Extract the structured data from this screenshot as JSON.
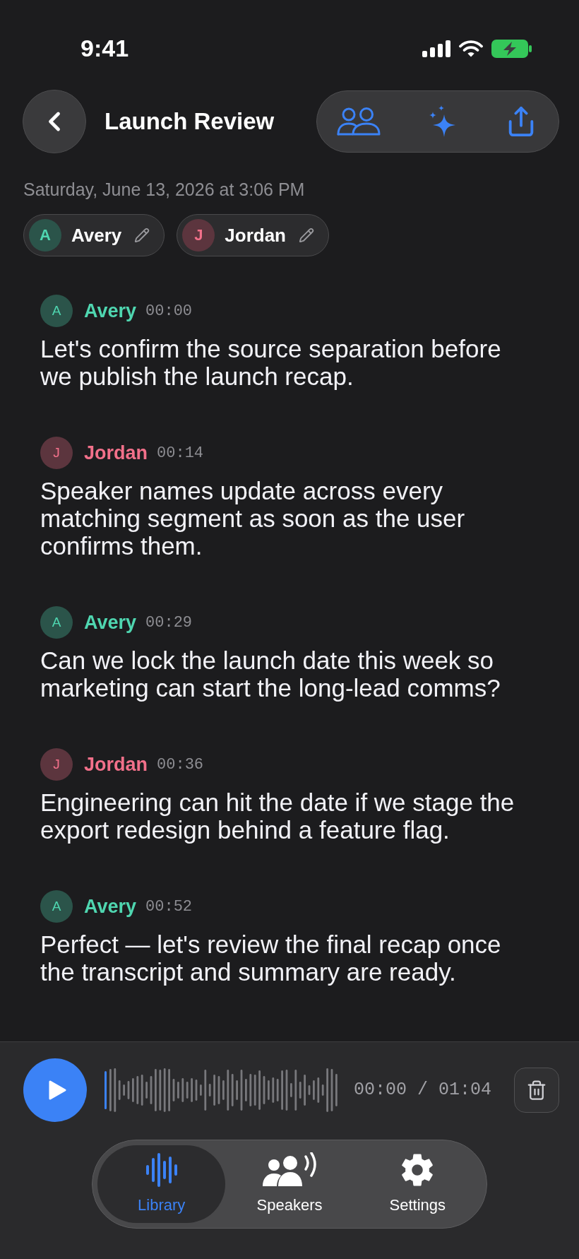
{
  "status_bar": {
    "time": "9:41"
  },
  "header": {
    "title": "Launch Review"
  },
  "date": "Saturday, June 13, 2026 at 3:06 PM",
  "speakers": [
    {
      "initial": "A",
      "name": "Avery",
      "color": "#4fd6b0"
    },
    {
      "initial": "J",
      "name": "Jordan",
      "color": "#f2708a"
    }
  ],
  "transcript": [
    {
      "initial": "A",
      "speaker": "Avery",
      "color": "#4fd6b0",
      "time": "00:00",
      "text": "Let's confirm the source separation before we publish the launch recap."
    },
    {
      "initial": "J",
      "speaker": "Jordan",
      "color": "#f2708a",
      "time": "00:14",
      "text": "Speaker names update across every matching segment as soon as the user confirms them."
    },
    {
      "initial": "A",
      "speaker": "Avery",
      "color": "#4fd6b0",
      "time": "00:29",
      "text": "Can we lock the launch date this week so marketing can start the long-lead comms?"
    },
    {
      "initial": "J",
      "speaker": "Jordan",
      "color": "#f2708a",
      "time": "00:36",
      "text": "Engineering can hit the date if we stage the export redesign behind a feature flag."
    },
    {
      "initial": "A",
      "speaker": "Avery",
      "color": "#4fd6b0",
      "time": "00:52",
      "text": "Perfect — let's review the final recap once the transcript and summary are ready."
    }
  ],
  "player": {
    "time": "00:00 / 01:04"
  },
  "tab_bar": [
    {
      "label": "Library",
      "selected": true
    },
    {
      "label": "Speakers",
      "selected": false
    },
    {
      "label": "Settings",
      "selected": false
    }
  ]
}
